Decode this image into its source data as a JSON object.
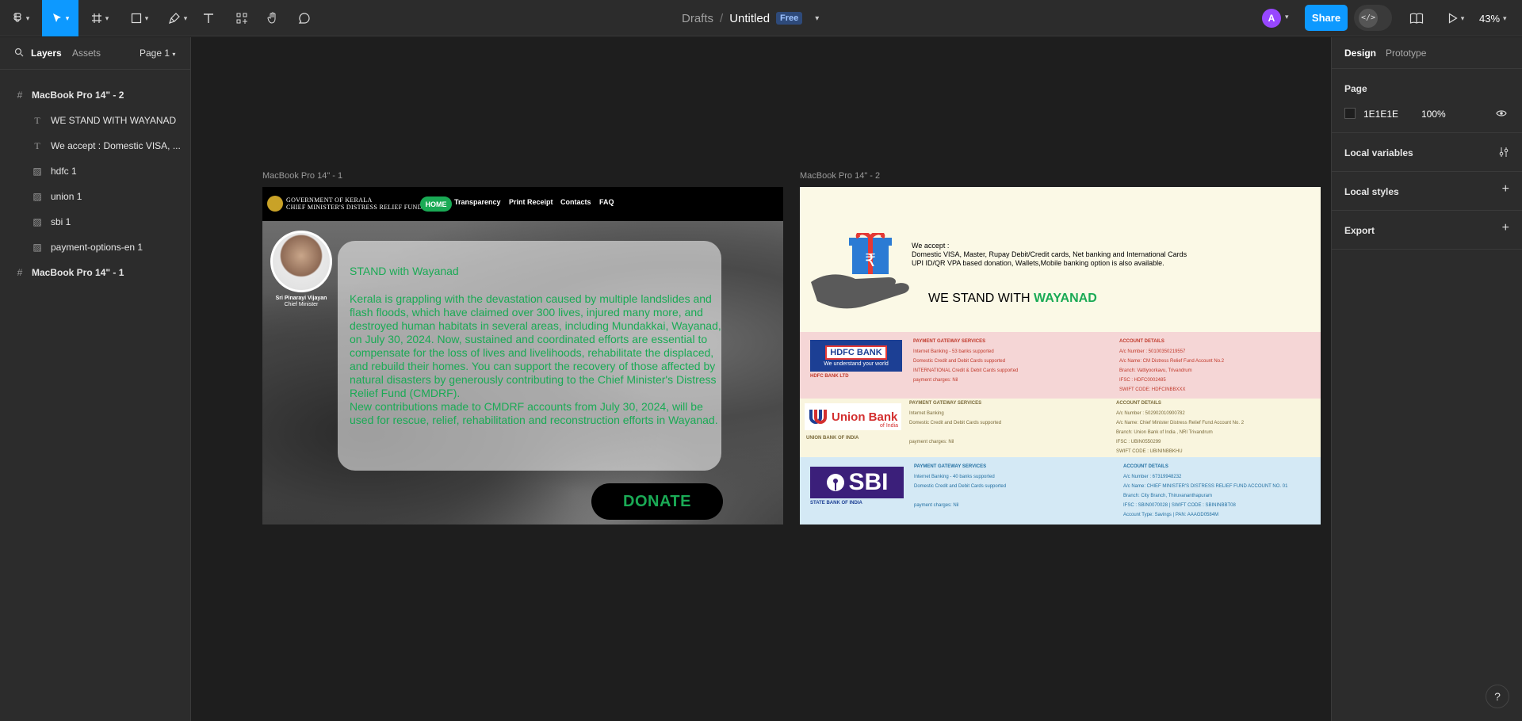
{
  "toolbar": {
    "breadcrumb_parent": "Drafts",
    "breadcrumb_sep": "/",
    "file_name": "Untitled",
    "plan_badge": "Free",
    "avatar_initial": "A",
    "share_label": "Share",
    "zoom": "43%",
    "accent": "#0d99ff"
  },
  "left_panel": {
    "tab_layers": "Layers",
    "tab_assets": "Assets",
    "page_selector": "Page 1",
    "layers": [
      {
        "name": "MacBook Pro 14\" - 2",
        "icon": "frame-icon"
      },
      {
        "name": "WE STAND WITH WAYANAD",
        "icon": "text-icon"
      },
      {
        "name": "We accept : Domestic VISA, ...",
        "icon": "text-icon"
      },
      {
        "name": "hdfc 1",
        "icon": "image-icon"
      },
      {
        "name": "union 1",
        "icon": "image-icon"
      },
      {
        "name": "sbi 1",
        "icon": "image-icon"
      },
      {
        "name": "payment-options-en 1",
        "icon": "image-icon"
      },
      {
        "name": "MacBook Pro 14\" - 1",
        "icon": "frame-icon"
      }
    ]
  },
  "right_panel": {
    "tab_design": "Design",
    "tab_prototype": "Prototype",
    "page_heading": "Page",
    "page_color": "1E1E1E",
    "page_opacity": "100%",
    "local_variables": "Local variables",
    "local_styles": "Local styles",
    "export": "Export"
  },
  "canvas": {
    "frame1_label": "MacBook Pro 14\" - 1",
    "frame2_label": "MacBook Pro 14\" - 2"
  },
  "frame1": {
    "org_line1": "GOVERNMENT OF KERALA",
    "org_line2": "CHIEF MINISTER'S DISTRESS RELIEF FUND",
    "nav_home": "HOME",
    "nav_transparency": "Transparency",
    "nav_print": "Print Receipt",
    "nav_contacts": "Contacts",
    "nav_faq": "FAQ",
    "cm_name": "Sri Pinarayi Vijayan",
    "cm_title": "Chief Minister",
    "heading": "STAND with Wayanad",
    "body": "Kerala is grappling with the devastation caused by multiple landslides and flash floods, which have claimed over 300 lives, injured many more, and destroyed human habitats in several areas, including Mundakkai, Wayanad, on July 30, 2024. Now, sustained and coordinated efforts are essential to compensate for the loss of lives and livelihoods, rehabilitate the displaced, and rebuild their homes. You can support the recovery of those affected by natural disasters by generously contributing to the Chief Minister's Distress Relief Fund (CMDRF).",
    "body2": "New contributions made to CMDRF accounts from July 30, 2024, will be used for rescue, relief, rehabilitation and reconstruction efforts in Wayanad.",
    "donate": "DONATE"
  },
  "frame2": {
    "accept_title": "We accept :",
    "accept_line1": "Domestic VISA, Master, Rupay Debit/Credit cards, Net banking and International Cards",
    "accept_line2": "UPI ID/QR VPA based donation, Wallets,Mobile banking option is also available.",
    "stand_prefix": "WE STAND WITH ",
    "stand_highlight": "WAYANAD",
    "banks": [
      {
        "logo": "HDFC BANK",
        "tagline": "We understand your world",
        "name": "HDFC BANK LTD",
        "pg_title": "PAYMENT GATEWAY SERVICES",
        "pg": [
          "Internet Banking - 53 banks supported",
          "Domestic Credit and Debit Cards supported",
          "INTERNATIONAL Credit & Debit Cards supported",
          "payment charges: Nil"
        ],
        "acc_title": "ACCOUNT DETAILS",
        "acc": [
          "A/c Number : 50100350219557",
          "A/c Name: CM Distress Relief Fund Account No.2",
          "Branch: Vattiyoorkavu, Trivandrum",
          "IFSC : HDFC0002485",
          "SWIFT CODE: HDFCINBBXXX"
        ],
        "bg": "#f5d6d6",
        "text_color": "#c0392b"
      },
      {
        "logo": "Union Bank",
        "tagline": "of India",
        "name": "UNION BANK OF INDIA",
        "pg_title": "PAYMENT GATEWAY SERVICES",
        "pg": [
          "Internet Banking",
          "Domestic Credit and Debit Cards supported",
          "",
          "payment charges: Nil"
        ],
        "acc_title": "ACCOUNT DETAILS",
        "acc": [
          "A/c Number : 502902010900782",
          "A/c Name: Chief Minister Distress Relief Fund Account No. 2",
          "Branch: Union Bank of India , NRI Trivandrum",
          "IFSC : UBIN0550299",
          "SWIFT CODE : UBININBBKHU"
        ],
        "bg": "#f9f5de",
        "text_color": "#7a6a3a"
      },
      {
        "logo": "SBI",
        "tagline": "",
        "name": "STATE BANK OF INDIA",
        "pg_title": "PAYMENT GATEWAY SERVICES",
        "pg": [
          "Internet Banking - 40 banks supported",
          "Domestic Credit and Debit Cards supported",
          "",
          "payment charges: Nil"
        ],
        "acc_title": "ACCOUNT DETAILS",
        "acc": [
          "A/c Number : 67319948232",
          "A/c Name: CHIEF MINISTER'S DISTRESS RELIEF FUND ACCOUNT NO. 01",
          "Branch: City Branch, Thiruvananthapuram",
          "IFSC : SBIN0070028 | SWIFT CODE : SBININBBT08",
          "Account Type: Savings | PAN: AAAGD0584M"
        ],
        "bg": "#d4e9f5",
        "text_color": "#2471a3"
      }
    ]
  },
  "help": "?"
}
